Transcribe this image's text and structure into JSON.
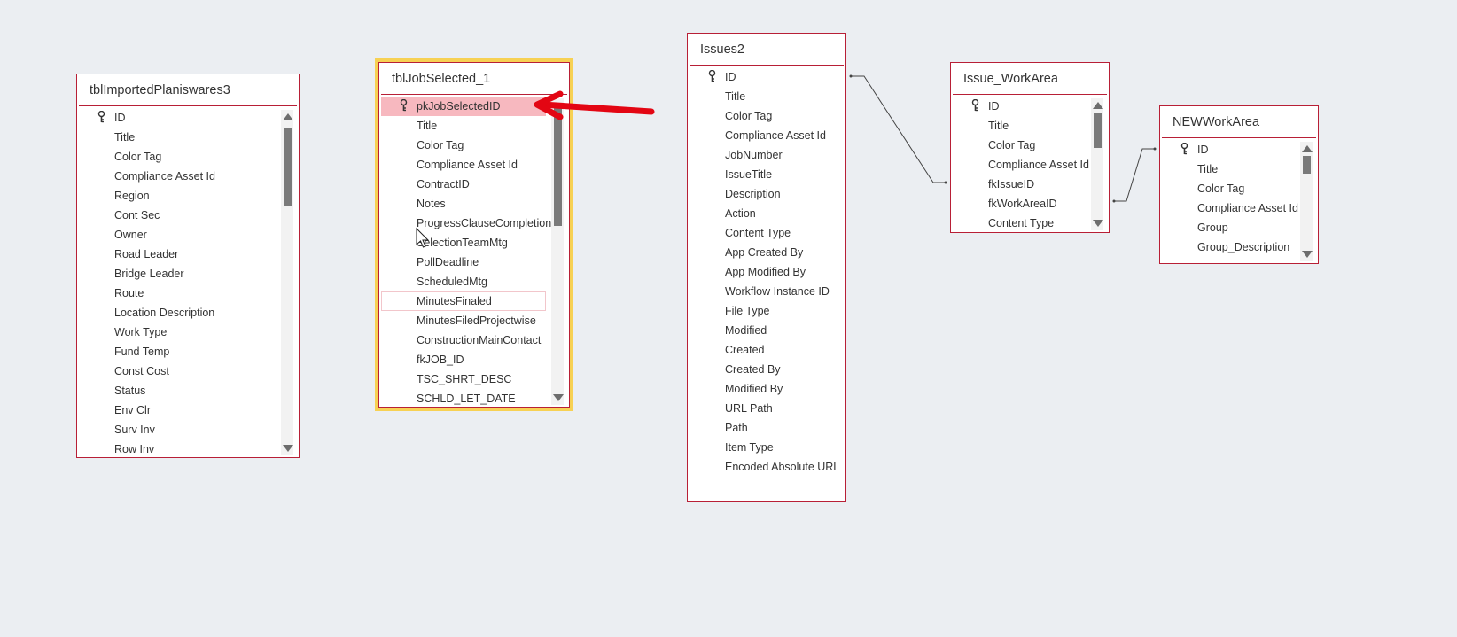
{
  "tables": {
    "planisware": {
      "title": "tblImportedPlaniswares3",
      "fields": [
        "ID",
        "Title",
        "Color Tag",
        "Compliance Asset Id",
        "Region",
        "Cont Sec",
        "Owner",
        "Road Leader",
        "Bridge Leader",
        "Route",
        "Location Description",
        "Work Type",
        "Fund Temp",
        "Const Cost",
        "Status",
        "Env Clr",
        "Surv Inv",
        "Row Inv"
      ]
    },
    "jobselected": {
      "title": "tblJobSelected_1",
      "fields": [
        "pkJobSelectedID",
        "Title",
        "Color Tag",
        "Compliance Asset Id",
        "ContractID",
        "Notes",
        "ProgressClauseCompletion",
        "SelectionTeamMtg",
        "PollDeadline",
        "ScheduledMtg",
        "MinutesFinaled",
        "MinutesFiledProjectwise",
        "ConstructionMainContact",
        "fkJOB_ID",
        "TSC_SHRT_DESC",
        "SCHLD_LET_DATE"
      ]
    },
    "issues2": {
      "title": "Issues2",
      "fields": [
        "ID",
        "Title",
        "Color Tag",
        "Compliance Asset Id",
        "JobNumber",
        "IssueTitle",
        "Description",
        "Action",
        "Content Type",
        "App Created By",
        "App Modified By",
        "Workflow Instance ID",
        "File Type",
        "Modified",
        "Created",
        "Created By",
        "Modified By",
        "URL Path",
        "Path",
        "Item Type",
        "Encoded Absolute URL"
      ]
    },
    "issueworkarea": {
      "title": "Issue_WorkArea",
      "fields": [
        "ID",
        "Title",
        "Color Tag",
        "Compliance Asset Id",
        "fkIssueID",
        "fkWorkAreaID",
        "Content Type"
      ]
    },
    "newworkarea": {
      "title": "NEWWorkArea",
      "fields": [
        "ID",
        "Title",
        "Color Tag",
        "Compliance Asset Id",
        "Group",
        "Group_Description"
      ]
    }
  },
  "colors": {
    "table_border": "#b81f36",
    "selected_outline": "#f7d154",
    "highlight_row": "#f7b8bf",
    "arrow": "#e30613"
  }
}
